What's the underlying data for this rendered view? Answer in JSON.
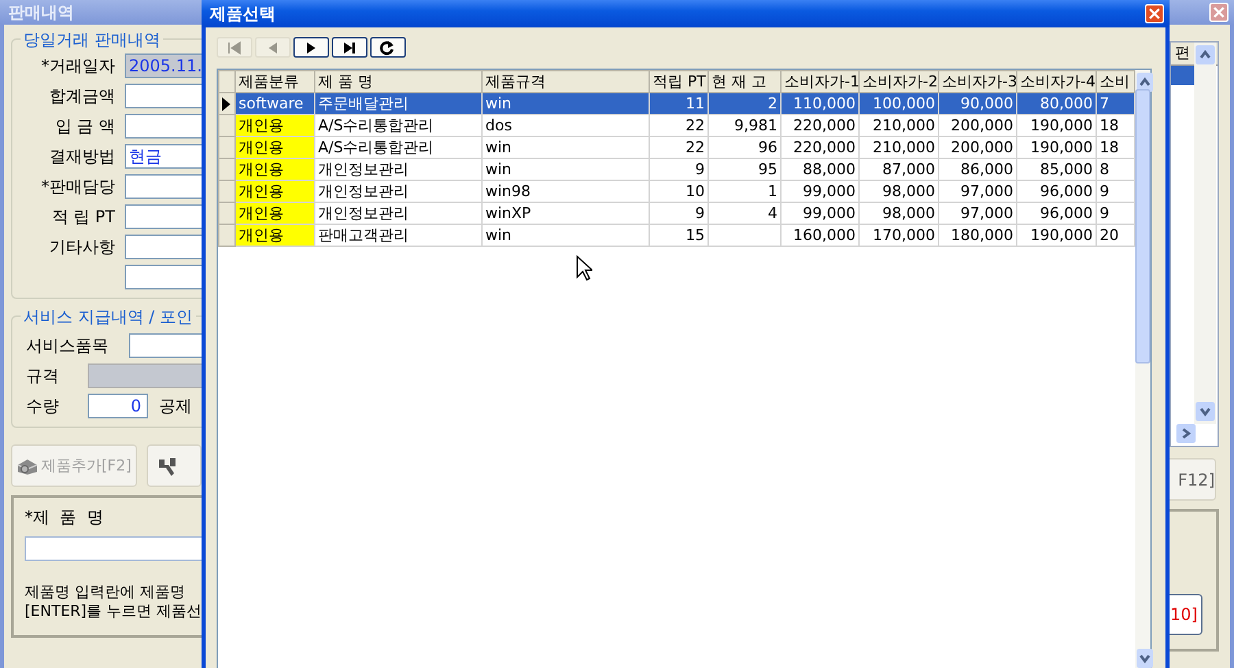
{
  "background_window": {
    "title": "판매내역",
    "sales_group": {
      "title": "당일거래 판매내역",
      "fields": [
        {
          "label": "*거래일자",
          "kind": "readonly",
          "value": "2005.11."
        },
        {
          "label": "합계금액",
          "kind": "text"
        },
        {
          "label": "입 금 액",
          "kind": "text"
        },
        {
          "label": "결재방법",
          "kind": "combo",
          "value": "현금"
        },
        {
          "label": "*판매담당",
          "kind": "text"
        },
        {
          "label": "적 립 PT",
          "kind": "text"
        },
        {
          "label": "기타사항",
          "kind": "text"
        },
        {
          "kind": "text"
        }
      ]
    },
    "service_group": {
      "title": "서비스 지급내역 / 포인",
      "item_label": "서비스품목",
      "spec_label": "규격",
      "quantity_label": "수량",
      "quantity_value": "0",
      "deduction_label": "공제"
    },
    "add_button": {
      "label": "제품추가[F2]",
      "disabled": true
    },
    "product_panel": {
      "label": "*제  품  명",
      "help_lines": [
        "제품명 입력란에 제품명",
        "[ENTER]를 누르면 제품선"
      ]
    },
    "side_grid": {
      "column": "편"
    },
    "right_button": {
      "label": "F12]"
    },
    "red_button": {
      "label": "10]"
    }
  },
  "dialog": {
    "title": "제품선택",
    "nav_buttons": [
      {
        "kind": "first",
        "disabled": true
      },
      {
        "kind": "prev",
        "disabled": true
      },
      {
        "kind": "next",
        "disabled": false
      },
      {
        "kind": "last",
        "disabled": false
      },
      {
        "kind": "refresh",
        "disabled": false
      }
    ],
    "table": {
      "columns": [
        "제품분류",
        "제 품 명",
        "제품규격",
        "적립 PT",
        "현 재 고",
        "소비자가-1",
        "소비자가-2",
        "소비자가-3",
        "소비자가-4",
        "소비"
      ],
      "rows": [
        {
          "selected": true,
          "highlight": false,
          "cells": [
            "software",
            "주문배달관리",
            "win",
            "11",
            "2",
            "110,000",
            "100,000",
            "90,000",
            "80,000",
            "7"
          ]
        },
        {
          "selected": false,
          "highlight": true,
          "cells": [
            "개인용",
            "A/S수리통합관리",
            "dos",
            "22",
            "9,981",
            "220,000",
            "210,000",
            "200,000",
            "190,000",
            "18"
          ]
        },
        {
          "selected": false,
          "highlight": true,
          "cells": [
            "개인용",
            "A/S수리통합관리",
            "win",
            "22",
            "96",
            "220,000",
            "210,000",
            "200,000",
            "190,000",
            "18"
          ]
        },
        {
          "selected": false,
          "highlight": true,
          "cells": [
            "개인용",
            "개인정보관리",
            "win",
            "9",
            "95",
            "88,000",
            "87,000",
            "86,000",
            "85,000",
            "8"
          ]
        },
        {
          "selected": false,
          "highlight": true,
          "cells": [
            "개인용",
            "개인정보관리",
            "win98",
            "10",
            "1",
            "99,000",
            "98,000",
            "97,000",
            "96,000",
            "9"
          ]
        },
        {
          "selected": false,
          "highlight": true,
          "cells": [
            "개인용",
            "개인정보관리",
            "winXP",
            "9",
            "4",
            "99,000",
            "98,000",
            "97,000",
            "96,000",
            "9"
          ]
        },
        {
          "selected": false,
          "highlight": true,
          "cells": [
            "개인용",
            "판매고객관리",
            "win",
            "15",
            "",
            "160,000",
            "170,000",
            "180,000",
            "190,000",
            "20"
          ]
        }
      ]
    }
  }
}
